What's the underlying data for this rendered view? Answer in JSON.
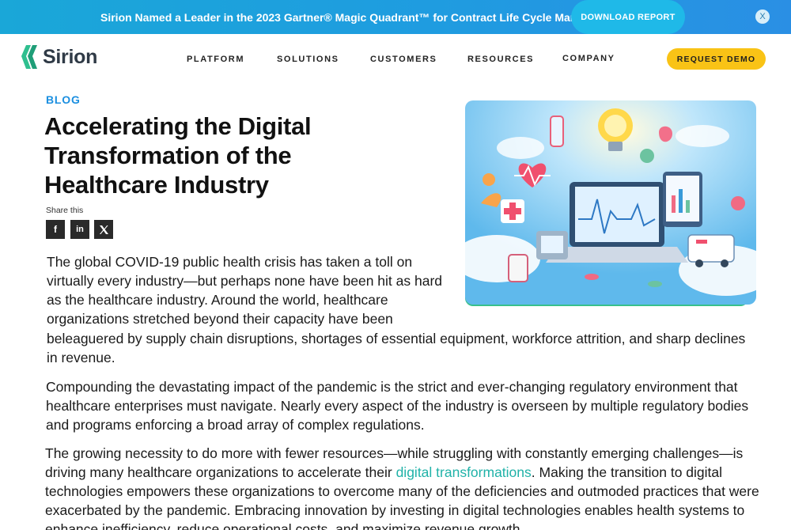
{
  "announcement": {
    "text": "Sirion Named a Leader in the 2023 Gartner® Magic Quadrant™ for Contract Life Cycle Management.",
    "button_label": "DOWNLOAD REPORT",
    "close_label": "X"
  },
  "header": {
    "logo_text": "Sirion",
    "nav": [
      "PLATFORM",
      "SOLUTIONS",
      "CUSTOMERS",
      "RESOURCES",
      "COMPANY"
    ],
    "cta_label": "REQUEST DEMO"
  },
  "article": {
    "eyebrow": "BLOG",
    "title": "Accelerating the Digital Transformation of the Healthcare Industry",
    "share_label": "Share this",
    "share_buttons": [
      {
        "icon": "facebook-icon",
        "glyph": "f"
      },
      {
        "icon": "linkedin-icon",
        "glyph": "in"
      },
      {
        "icon": "x-icon",
        "glyph": "𝕏"
      }
    ],
    "p1_top": "The global COVID-19 public health crisis has taken a toll on virtually every industry—but perhaps none have been hit as hard as the healthcare industry. Around the world, healthcare organizations stretched beyond their capacity have been",
    "p1_bottom": "beleaguered by supply chain disruptions, shortages of essential equipment, workforce attrition, and sharp declines in revenue.",
    "p2": "Compounding the devastating impact of the pandemic is the strict and ever-changing regulatory environment that healthcare enterprises must navigate. Nearly every aspect of the industry is overseen by multiple regulatory bodies and programs enforcing a broad array of complex regulations.",
    "p3_before": "The growing necessity to do more with fewer resources—while struggling with constantly emerging challenges—is driving many healthcare organizations to accelerate their ",
    "p3_link": "digital transformations",
    "p3_after": ". Making the transition to digital technologies empowers these organizations to overcome many of the deficiencies and outmoded practices that were exacerbated by the pandemic. Embracing innovation by investing in digital technologies enables health systems to enhance inefficiency, reduce operational costs, and maximize revenue growth."
  },
  "colors": {
    "announce_bar": "#1f9ce0",
    "cta_yellow": "#f9c316",
    "eyebrow_blue": "#1b8fe0",
    "link_teal": "#20b2a8",
    "logo_green": "#2fbf8f"
  }
}
